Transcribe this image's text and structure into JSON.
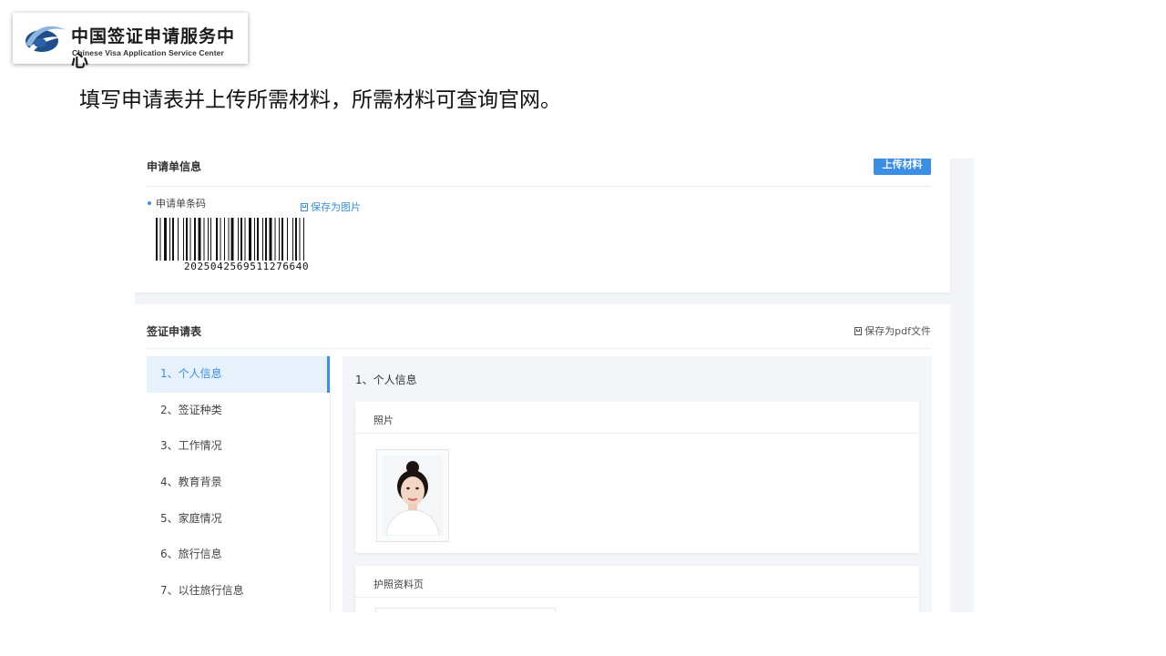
{
  "logo": {
    "cn_text": "中国签证申请服务中心",
    "en_text": "Chinese Visa Application Service Center"
  },
  "heading": "填写申请表并上传所需材料，所需材料可查询官网。",
  "application_info": {
    "title": "申请单信息",
    "upload_button": "上传材料",
    "barcode_label": "申请单条码",
    "save_as_image": "保存为图片",
    "barcode_number": "2025042569511276640"
  },
  "visa_form": {
    "title": "签证申请表",
    "save_as_pdf": "保存为pdf文件",
    "nav_items": [
      {
        "label": "1、个人信息",
        "active": true
      },
      {
        "label": "2、签证种类",
        "active": false
      },
      {
        "label": "3、工作情况",
        "active": false
      },
      {
        "label": "4、教育背景",
        "active": false
      },
      {
        "label": "5、家庭情况",
        "active": false
      },
      {
        "label": "6、旅行信息",
        "active": false
      },
      {
        "label": "7、以往旅行信息",
        "active": false
      }
    ],
    "section_title": "1、个人信息",
    "photo_panel_title": "照片",
    "passport_panel_title": "护照资料页"
  },
  "colors": {
    "accent": "#3a8ee6",
    "active_nav_bg": "#e6f1fc"
  }
}
